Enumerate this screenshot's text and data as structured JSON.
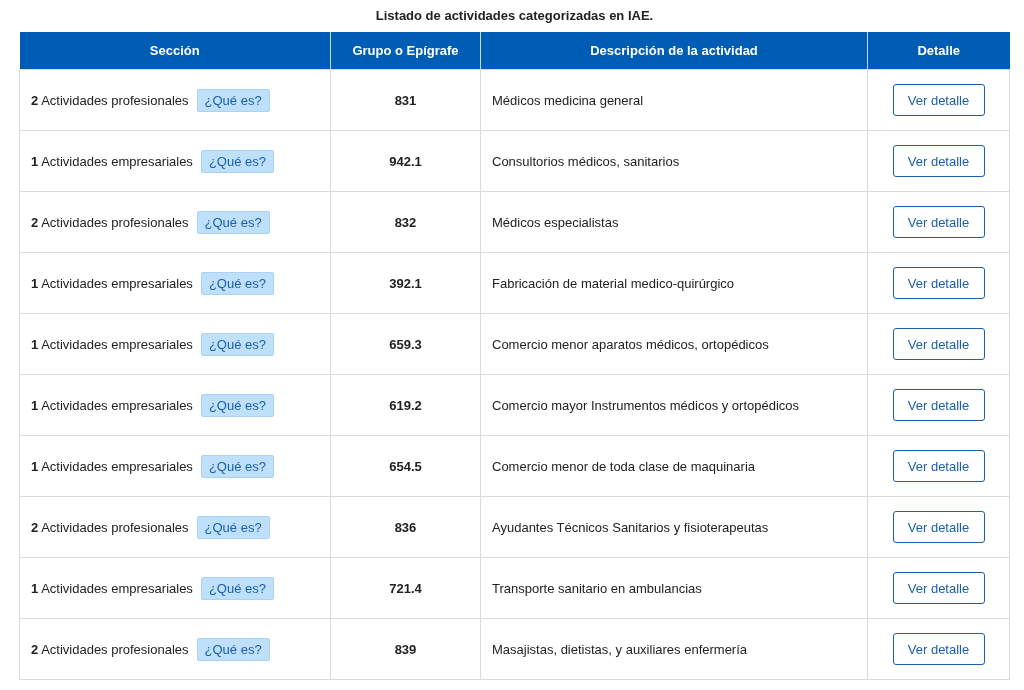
{
  "title": "Listado de actividades categorizadas en IAE.",
  "table": {
    "columns": [
      "Sección",
      "Grupo o Epígrafe",
      "Descripción de la actividad",
      "Detalle"
    ],
    "rows": [
      {
        "section": "**2** Actividades profesionales",
        "info_button": "¿Qué es?",
        "group": "831",
        "description": "Médicos medicina general",
        "action": "Ver detalle"
      },
      {
        "section": "**1** Actividades empresariales",
        "info_button": "¿Qué es?",
        "group": "942.1",
        "description": "Consultorios médicos, sanitarios",
        "action": "Ver detalle"
      },
      {
        "section": "**2** Actividades profesionales",
        "info_button": "¿Qué es?",
        "group": "832",
        "description": "Médicos especialistas",
        "action": "Ver detalle"
      },
      {
        "section": "**1** Actividades empresariales",
        "info_button": "¿Qué es?",
        "group": "392.1",
        "description": "Fabricación de material medico-quirúrgico",
        "action": "Ver detalle"
      },
      {
        "section": "**1** Actividades empresariales",
        "info_button": "¿Qué es?",
        "group": "659.3",
        "description": "Comercio menor aparatos médicos, ortopédicos",
        "action": "Ver detalle"
      },
      {
        "section": "**1** Actividades empresariales",
        "info_button": "¿Qué es?",
        "group": "619.2",
        "description": "Comercio mayor Instrumentos médicos y ortopédicos",
        "action": "Ver detalle"
      },
      {
        "section": "**1** Actividades empresariales",
        "info_button": "¿Qué es?",
        "group": "654.5",
        "description": "Comercio menor de toda clase de maquinaria",
        "action": "Ver detalle"
      },
      {
        "section": "**2** Actividades profesionales",
        "info_button": "¿Qué es?",
        "group": "836",
        "description": "Ayudantes Técnicos Sanitarios y fisioterapeutas",
        "action": "Ver detalle"
      },
      {
        "section": "**1** Actividades empresariales",
        "info_button": "¿Qué es?",
        "group": "721.4",
        "description": "Transporte sanitario en ambulancias",
        "action": "Ver detalle"
      },
      {
        "section": "**2** Actividades profesionales",
        "info_button": "¿Qué es?",
        "group": "839",
        "description": "Masajistas, dietistas, y auxiliares enfermería",
        "action": "Ver detalle"
      }
    ]
  }
}
